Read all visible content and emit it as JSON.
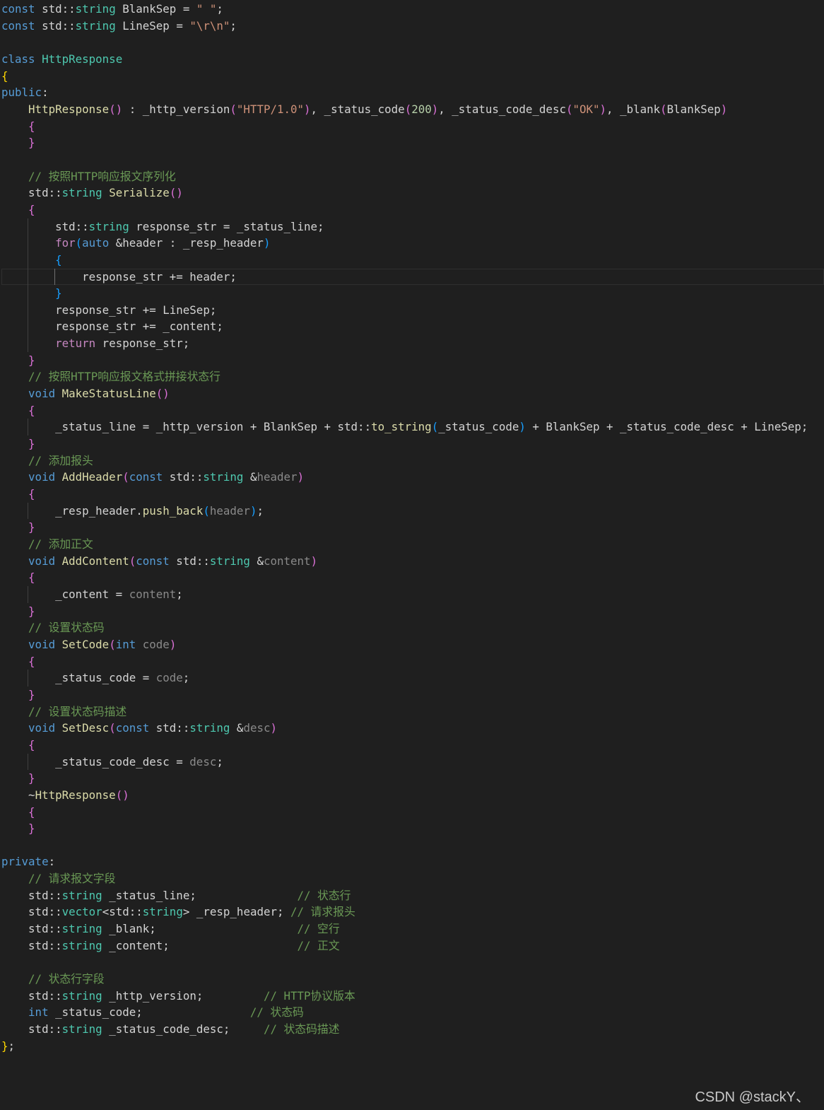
{
  "editor": {
    "lines": [
      {
        "guides": [],
        "tokens": [
          [
            "kw",
            "const"
          ],
          [
            "pl",
            " std::"
          ],
          [
            "ty",
            "string"
          ],
          [
            "pl",
            " BlankSep = "
          ],
          [
            "str",
            "\" \""
          ],
          [
            "pl",
            ";"
          ]
        ]
      },
      {
        "guides": [],
        "tokens": [
          [
            "kw",
            "const"
          ],
          [
            "pl",
            " std::"
          ],
          [
            "ty",
            "string"
          ],
          [
            "pl",
            " LineSep = "
          ],
          [
            "str",
            "\"\\r\\n\""
          ],
          [
            "pl",
            ";"
          ]
        ]
      },
      {
        "guides": [],
        "tokens": []
      },
      {
        "guides": [],
        "tokens": [
          [
            "kw",
            "class"
          ],
          [
            "pl",
            " "
          ],
          [
            "ty",
            "HttpResponse"
          ]
        ]
      },
      {
        "guides": [],
        "tokens": [
          [
            "b1",
            "{"
          ]
        ]
      },
      {
        "guides": [],
        "tokens": [
          [
            "kw",
            "public"
          ],
          [
            "pl",
            ":"
          ]
        ]
      },
      {
        "guides": [],
        "tokens": [
          [
            "pl",
            "    "
          ],
          [
            "fn",
            "HttpResponse"
          ],
          [
            "b2",
            "()"
          ],
          [
            "pl",
            " : _http_version"
          ],
          [
            "b2",
            "("
          ],
          [
            "str",
            "\"HTTP/1.0\""
          ],
          [
            "b2",
            ")"
          ],
          [
            "pl",
            ", _status_code"
          ],
          [
            "b2",
            "("
          ],
          [
            "num",
            "200"
          ],
          [
            "b2",
            ")"
          ],
          [
            "pl",
            ", _status_code_desc"
          ],
          [
            "b2",
            "("
          ],
          [
            "str",
            "\"OK\""
          ],
          [
            "b2",
            ")"
          ],
          [
            "pl",
            ", _blank"
          ],
          [
            "b2",
            "("
          ],
          [
            "pl",
            "BlankSep"
          ],
          [
            "b2",
            ")"
          ]
        ]
      },
      {
        "guides": [],
        "tokens": [
          [
            "pl",
            "    "
          ],
          [
            "b2",
            "{"
          ]
        ]
      },
      {
        "guides": [],
        "tokens": [
          [
            "pl",
            "    "
          ],
          [
            "b2",
            "}"
          ]
        ]
      },
      {
        "guides": [],
        "tokens": []
      },
      {
        "guides": [],
        "tokens": [
          [
            "pl",
            "    "
          ],
          [
            "cm",
            "// 按照HTTP响应报文序列化"
          ]
        ]
      },
      {
        "guides": [],
        "tokens": [
          [
            "pl",
            "    std::"
          ],
          [
            "ty",
            "string"
          ],
          [
            "pl",
            " "
          ],
          [
            "fn",
            "Serialize"
          ],
          [
            "b2",
            "()"
          ]
        ]
      },
      {
        "guides": [],
        "tokens": [
          [
            "pl",
            "    "
          ],
          [
            "b2",
            "{"
          ]
        ]
      },
      {
        "guides": [
          1
        ],
        "tokens": [
          [
            "pl",
            "        std::"
          ],
          [
            "ty",
            "string"
          ],
          [
            "pl",
            " response_str = _status_line;"
          ]
        ]
      },
      {
        "guides": [
          1
        ],
        "tokens": [
          [
            "pl",
            "        "
          ],
          [
            "ctl",
            "for"
          ],
          [
            "b3",
            "("
          ],
          [
            "kw",
            "auto"
          ],
          [
            "pl",
            " &header : _resp_header"
          ],
          [
            "b3",
            ")"
          ]
        ]
      },
      {
        "guides": [
          1
        ],
        "tokens": [
          [
            "pl",
            "        "
          ],
          [
            "b3",
            "{"
          ]
        ]
      },
      {
        "guides": [
          1,
          2
        ],
        "current": true,
        "tokens": [
          [
            "pl",
            "            response_str += header;"
          ]
        ]
      },
      {
        "guides": [
          1
        ],
        "tokens": [
          [
            "pl",
            "        "
          ],
          [
            "b3",
            "}"
          ]
        ]
      },
      {
        "guides": [
          1
        ],
        "tokens": [
          [
            "pl",
            "        response_str += LineSep;"
          ]
        ]
      },
      {
        "guides": [
          1
        ],
        "tokens": [
          [
            "pl",
            "        response_str += _content;"
          ]
        ]
      },
      {
        "guides": [
          1
        ],
        "tokens": [
          [
            "pl",
            "        "
          ],
          [
            "ctl",
            "return"
          ],
          [
            "pl",
            " response_str;"
          ]
        ]
      },
      {
        "guides": [],
        "tokens": [
          [
            "pl",
            "    "
          ],
          [
            "b2",
            "}"
          ]
        ]
      },
      {
        "guides": [],
        "tokens": [
          [
            "pl",
            "    "
          ],
          [
            "cm",
            "// 按照HTTP响应报文格式拼接状态行"
          ]
        ]
      },
      {
        "guides": [],
        "tokens": [
          [
            "pl",
            "    "
          ],
          [
            "kw",
            "void"
          ],
          [
            "pl",
            " "
          ],
          [
            "fn",
            "MakeStatusLine"
          ],
          [
            "b2",
            "()"
          ]
        ]
      },
      {
        "guides": [],
        "tokens": [
          [
            "pl",
            "    "
          ],
          [
            "b2",
            "{"
          ]
        ]
      },
      {
        "guides": [
          1
        ],
        "tokens": [
          [
            "pl",
            "        _status_line = _http_version + BlankSep + std::"
          ],
          [
            "fn",
            "to_string"
          ],
          [
            "b3",
            "("
          ],
          [
            "pl",
            "_status_code"
          ],
          [
            "b3",
            ")"
          ],
          [
            "pl",
            " + BlankSep + _status_code_desc + LineSep;"
          ]
        ]
      },
      {
        "guides": [],
        "tokens": [
          [
            "pl",
            "    "
          ],
          [
            "b2",
            "}"
          ]
        ]
      },
      {
        "guides": [],
        "tokens": [
          [
            "pl",
            "    "
          ],
          [
            "cm",
            "// 添加报头"
          ]
        ]
      },
      {
        "guides": [],
        "tokens": [
          [
            "pl",
            "    "
          ],
          [
            "kw",
            "void"
          ],
          [
            "pl",
            " "
          ],
          [
            "fn",
            "AddHeader"
          ],
          [
            "b2",
            "("
          ],
          [
            "kw",
            "const"
          ],
          [
            "pl",
            " std::"
          ],
          [
            "ty",
            "string"
          ],
          [
            "pl",
            " &"
          ],
          [
            "prm",
            "header"
          ],
          [
            "b2",
            ")"
          ]
        ]
      },
      {
        "guides": [],
        "tokens": [
          [
            "pl",
            "    "
          ],
          [
            "b2",
            "{"
          ]
        ]
      },
      {
        "guides": [
          1
        ],
        "tokens": [
          [
            "pl",
            "        _resp_header."
          ],
          [
            "fn",
            "push_back"
          ],
          [
            "b3",
            "("
          ],
          [
            "prm",
            "header"
          ],
          [
            "b3",
            ")"
          ],
          [
            "pl",
            ";"
          ]
        ]
      },
      {
        "guides": [],
        "tokens": [
          [
            "pl",
            "    "
          ],
          [
            "b2",
            "}"
          ]
        ]
      },
      {
        "guides": [],
        "tokens": [
          [
            "pl",
            "    "
          ],
          [
            "cm",
            "// 添加正文"
          ]
        ]
      },
      {
        "guides": [],
        "tokens": [
          [
            "pl",
            "    "
          ],
          [
            "kw",
            "void"
          ],
          [
            "pl",
            " "
          ],
          [
            "fn",
            "AddContent"
          ],
          [
            "b2",
            "("
          ],
          [
            "kw",
            "const"
          ],
          [
            "pl",
            " std::"
          ],
          [
            "ty",
            "string"
          ],
          [
            "pl",
            " &"
          ],
          [
            "prm",
            "content"
          ],
          [
            "b2",
            ")"
          ]
        ]
      },
      {
        "guides": [],
        "tokens": [
          [
            "pl",
            "    "
          ],
          [
            "b2",
            "{"
          ]
        ]
      },
      {
        "guides": [
          1
        ],
        "tokens": [
          [
            "pl",
            "        _content = "
          ],
          [
            "prm",
            "content"
          ],
          [
            "pl",
            ";"
          ]
        ]
      },
      {
        "guides": [],
        "tokens": [
          [
            "pl",
            "    "
          ],
          [
            "b2",
            "}"
          ]
        ]
      },
      {
        "guides": [],
        "tokens": [
          [
            "pl",
            "    "
          ],
          [
            "cm",
            "// 设置状态码"
          ]
        ]
      },
      {
        "guides": [],
        "tokens": [
          [
            "pl",
            "    "
          ],
          [
            "kw",
            "void"
          ],
          [
            "pl",
            " "
          ],
          [
            "fn",
            "SetCode"
          ],
          [
            "b2",
            "("
          ],
          [
            "kw",
            "int"
          ],
          [
            "pl",
            " "
          ],
          [
            "prm",
            "code"
          ],
          [
            "b2",
            ")"
          ]
        ]
      },
      {
        "guides": [],
        "tokens": [
          [
            "pl",
            "    "
          ],
          [
            "b2",
            "{"
          ]
        ]
      },
      {
        "guides": [
          1
        ],
        "tokens": [
          [
            "pl",
            "        _status_code = "
          ],
          [
            "prm",
            "code"
          ],
          [
            "pl",
            ";"
          ]
        ]
      },
      {
        "guides": [],
        "tokens": [
          [
            "pl",
            "    "
          ],
          [
            "b2",
            "}"
          ]
        ]
      },
      {
        "guides": [],
        "tokens": [
          [
            "pl",
            "    "
          ],
          [
            "cm",
            "// 设置状态码描述"
          ]
        ]
      },
      {
        "guides": [],
        "tokens": [
          [
            "pl",
            "    "
          ],
          [
            "kw",
            "void"
          ],
          [
            "pl",
            " "
          ],
          [
            "fn",
            "SetDesc"
          ],
          [
            "b2",
            "("
          ],
          [
            "kw",
            "const"
          ],
          [
            "pl",
            " std::"
          ],
          [
            "ty",
            "string"
          ],
          [
            "pl",
            " &"
          ],
          [
            "prm",
            "desc"
          ],
          [
            "b2",
            ")"
          ]
        ]
      },
      {
        "guides": [],
        "tokens": [
          [
            "pl",
            "    "
          ],
          [
            "b2",
            "{"
          ]
        ]
      },
      {
        "guides": [
          1
        ],
        "tokens": [
          [
            "pl",
            "        _status_code_desc = "
          ],
          [
            "prm",
            "desc"
          ],
          [
            "pl",
            ";"
          ]
        ]
      },
      {
        "guides": [],
        "tokens": [
          [
            "pl",
            "    "
          ],
          [
            "b2",
            "}"
          ]
        ]
      },
      {
        "guides": [],
        "tokens": [
          [
            "pl",
            "    ~"
          ],
          [
            "fn",
            "HttpResponse"
          ],
          [
            "b2",
            "()"
          ]
        ]
      },
      {
        "guides": [],
        "tokens": [
          [
            "pl",
            "    "
          ],
          [
            "b2",
            "{"
          ]
        ]
      },
      {
        "guides": [],
        "tokens": [
          [
            "pl",
            "    "
          ],
          [
            "b2",
            "}"
          ]
        ]
      },
      {
        "guides": [],
        "tokens": []
      },
      {
        "guides": [],
        "tokens": [
          [
            "kw",
            "private"
          ],
          [
            "pl",
            ":"
          ]
        ]
      },
      {
        "guides": [],
        "tokens": [
          [
            "pl",
            "    "
          ],
          [
            "cm",
            "// 请求报文字段"
          ]
        ]
      },
      {
        "guides": [],
        "tokens": [
          [
            "pl",
            "    std::"
          ],
          [
            "ty",
            "string"
          ],
          [
            "pl",
            " _status_line;               "
          ],
          [
            "cm",
            "// 状态行"
          ]
        ]
      },
      {
        "guides": [],
        "tokens": [
          [
            "pl",
            "    std::"
          ],
          [
            "ty",
            "vector"
          ],
          [
            "pl",
            "<std::"
          ],
          [
            "ty",
            "string"
          ],
          [
            "pl",
            "> _resp_header; "
          ],
          [
            "cm",
            "// 请求报头"
          ]
        ]
      },
      {
        "guides": [],
        "tokens": [
          [
            "pl",
            "    std::"
          ],
          [
            "ty",
            "string"
          ],
          [
            "pl",
            " _blank;                     "
          ],
          [
            "cm",
            "// 空行"
          ]
        ]
      },
      {
        "guides": [],
        "tokens": [
          [
            "pl",
            "    std::"
          ],
          [
            "ty",
            "string"
          ],
          [
            "pl",
            " _content;                   "
          ],
          [
            "cm",
            "// 正文"
          ]
        ]
      },
      {
        "guides": [],
        "tokens": []
      },
      {
        "guides": [],
        "tokens": [
          [
            "pl",
            "    "
          ],
          [
            "cm",
            "// 状态行字段"
          ]
        ]
      },
      {
        "guides": [],
        "tokens": [
          [
            "pl",
            "    std::"
          ],
          [
            "ty",
            "string"
          ],
          [
            "pl",
            " _http_version;         "
          ],
          [
            "cm",
            "// HTTP协议版本"
          ]
        ]
      },
      {
        "guides": [],
        "tokens": [
          [
            "pl",
            "    "
          ],
          [
            "kw",
            "int"
          ],
          [
            "pl",
            " _status_code;                "
          ],
          [
            "cm",
            "// 状态码"
          ]
        ]
      },
      {
        "guides": [],
        "tokens": [
          [
            "pl",
            "    std::"
          ],
          [
            "ty",
            "string"
          ],
          [
            "pl",
            " _status_code_desc;     "
          ],
          [
            "cm",
            "// 状态码描述"
          ]
        ]
      },
      {
        "guides": [],
        "tokens": [
          [
            "b1",
            "}"
          ],
          [
            "pl",
            ";"
          ]
        ]
      }
    ]
  },
  "watermark": {
    "text": "CSDN @stackY、"
  }
}
